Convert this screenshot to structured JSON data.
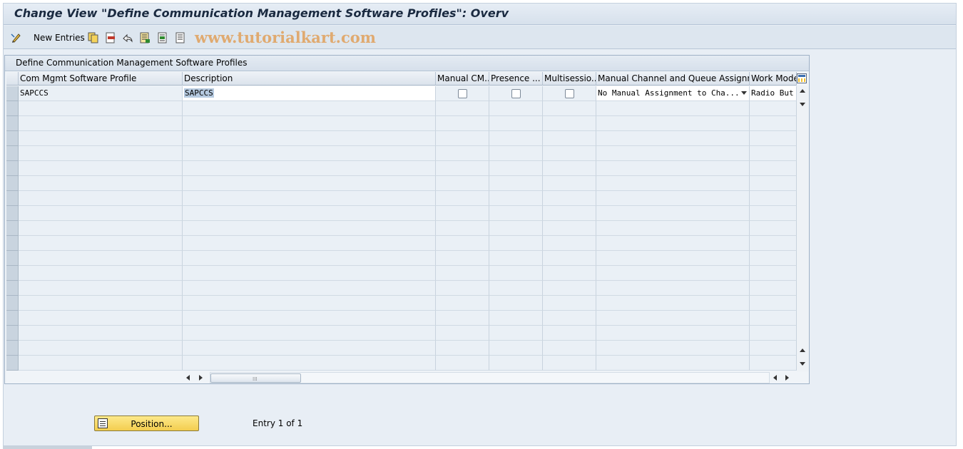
{
  "window": {
    "title": "Change View \"Define Communication Management Software Profiles\": Overv"
  },
  "toolbar": {
    "new_entries_label": "New Entries",
    "watermark": "www.tutorialkart.com",
    "icons": [
      "change-display-icon",
      "copy-icon",
      "delete-icon",
      "undo-icon",
      "select-all-icon",
      "select-block-icon",
      "deselect-all-icon"
    ]
  },
  "table": {
    "caption": "Define Communication Management Software Profiles",
    "columns": [
      "Com Mgmt Software Profile",
      "Description",
      "Manual CM...",
      "Presence ...",
      "Multisessio...",
      "Manual Channel and Queue Assignm...",
      "Work Mode"
    ],
    "rows": [
      {
        "profile": "SAPCCS",
        "description": "SAPCCS",
        "manual_cm": false,
        "presence": false,
        "multisession": false,
        "manual_channel": "No Manual Assignment to Cha...",
        "work_mode": "Radio But"
      }
    ]
  },
  "footer": {
    "position_button": "Position...",
    "entry_info": "Entry 1 of 1"
  }
}
